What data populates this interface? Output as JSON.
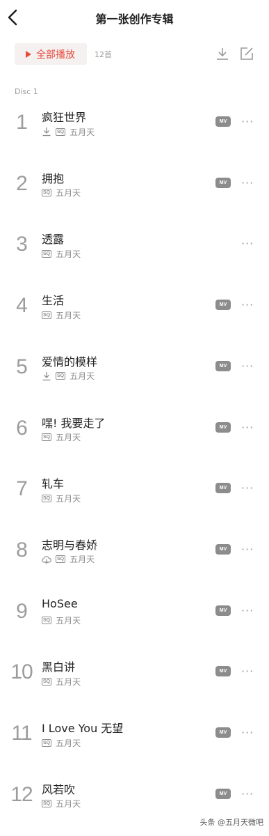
{
  "header": {
    "title": "第一张创作专辑"
  },
  "toolbar": {
    "play_all_label": "全部播放",
    "count": "12首"
  },
  "disc": {
    "label": "Disc 1"
  },
  "mv_label": "MV",
  "more_label": "···",
  "tracks": [
    {
      "num": "1",
      "name": "疯狂世界",
      "artist": "五月天",
      "sq": "SQ",
      "status_icon": "downloaded-icon",
      "has_mv": true
    },
    {
      "num": "2",
      "name": "拥抱",
      "artist": "五月天",
      "sq": "SQ",
      "status_icon": "",
      "has_mv": true
    },
    {
      "num": "3",
      "name": "透露",
      "artist": "五月天",
      "sq": "SQ",
      "status_icon": "",
      "has_mv": false
    },
    {
      "num": "4",
      "name": "生活",
      "artist": "五月天",
      "sq": "SQ",
      "status_icon": "",
      "has_mv": true
    },
    {
      "num": "5",
      "name": "爱情的模样",
      "artist": "五月天",
      "sq": "SQ",
      "status_icon": "downloaded-icon",
      "has_mv": true
    },
    {
      "num": "6",
      "name": "嘿! 我要走了",
      "artist": "五月天",
      "sq": "SQ",
      "status_icon": "",
      "has_mv": true
    },
    {
      "num": "7",
      "name": "轧车",
      "artist": "五月天",
      "sq": "SQ",
      "status_icon": "",
      "has_mv": true
    },
    {
      "num": "8",
      "name": "志明与春娇",
      "artist": "五月天",
      "sq": "SQ",
      "status_icon": "cloud-icon",
      "has_mv": true
    },
    {
      "num": "9",
      "name": "HoSee",
      "artist": "五月天",
      "sq": "SQ",
      "status_icon": "",
      "has_mv": true
    },
    {
      "num": "10",
      "name": "黑白讲",
      "artist": "五月天",
      "sq": "SQ",
      "status_icon": "",
      "has_mv": true
    },
    {
      "num": "11",
      "name": "I Love You 无望",
      "artist": "五月天",
      "sq": "SQ",
      "status_icon": "",
      "has_mv": true
    },
    {
      "num": "12",
      "name": "风若吹",
      "artist": "五月天",
      "sq": "SQ",
      "status_icon": "",
      "has_mv": true
    }
  ],
  "watermark": "头条 @五月天微吧",
  "colors": {
    "accent": "#e64a3b",
    "play_bg": "#f6f1f1",
    "muted": "#9a9a9a"
  }
}
